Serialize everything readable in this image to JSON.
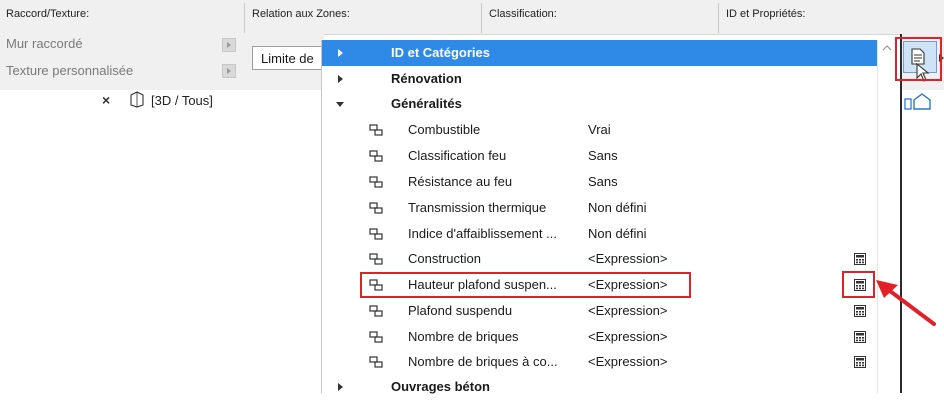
{
  "header": {
    "col1": "Raccord/Texture:",
    "col2": "Relation aux Zones:",
    "col3": "Classification:",
    "col4": "ID et Propriétés:"
  },
  "left_panel": {
    "item1": "Mur raccordé",
    "item2": "Texture personnalisée"
  },
  "zone_relation_value": "Limite de",
  "tab": {
    "close": "×",
    "label": "[3D / Tous]"
  },
  "dropdown": {
    "categories": {
      "id": "ID et Catégories",
      "renovation": "Rénovation",
      "generalites": "Généralités",
      "ouvrages": "Ouvrages béton"
    },
    "properties": [
      {
        "name": "Combustible",
        "value": "Vrai",
        "calc": false
      },
      {
        "name": "Classification feu",
        "value": "Sans",
        "calc": false
      },
      {
        "name": "Résistance au feu",
        "value": "Sans",
        "calc": false
      },
      {
        "name": "Transmission thermique",
        "value": "Non défini",
        "calc": false
      },
      {
        "name": "Indice d'affaiblissement ...",
        "value": "Non défini",
        "calc": false
      },
      {
        "name": "Construction",
        "value": "<Expression>",
        "calc": true
      },
      {
        "name": "Hauteur plafond suspen...",
        "value": "<Expression>",
        "calc": true
      },
      {
        "name": "Plafond suspendu",
        "value": "<Expression>",
        "calc": true
      },
      {
        "name": "Nombre de briques",
        "value": "<Expression>",
        "calc": true
      },
      {
        "name": "Nombre de briques à co...",
        "value": "<Expression>",
        "calc": true
      }
    ]
  },
  "colors": {
    "selection": "#2e8ae6",
    "highlight": "#e3202a",
    "panel_bg": "#f0f0f0"
  },
  "icons": [
    "property-link-icon",
    "calculator-icon",
    "document-icon",
    "house-icon",
    "wall-3d-icon",
    "red-arrow-icon",
    "cursor-icon"
  ]
}
